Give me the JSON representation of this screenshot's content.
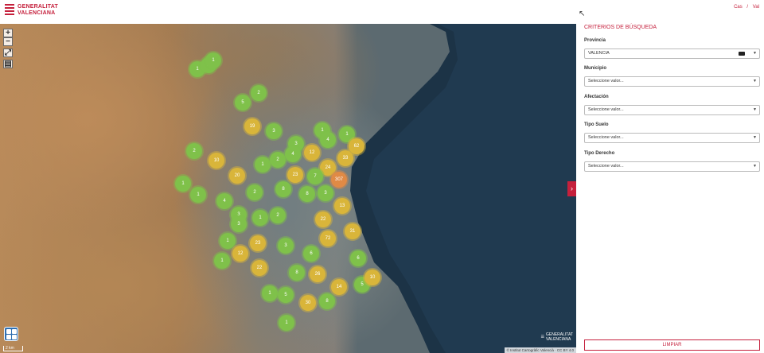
{
  "header": {
    "logo_line1": "GENERALITAT",
    "logo_line2": "VALENCIANA",
    "lang_es": "Cas",
    "lang_sep": "/",
    "lang_va": "Val"
  },
  "map": {
    "zoom_in": "+",
    "zoom_out": "−",
    "scale_text": "2 km",
    "attribution": "© Institut Cartogràfic Valencià · CC BY 4.0",
    "watermark_line1": "GENERALITAT",
    "watermark_line2": "VALENCIANA",
    "clusters": [
      {
        "label": "1",
        "color": "g",
        "c": 1
      },
      {
        "label": "1",
        "color": "g",
        "c": 2
      },
      {
        "label": "1",
        "color": "g",
        "c": 3
      },
      {
        "label": "5",
        "color": "g",
        "c": 4
      },
      {
        "label": "2",
        "color": "g",
        "c": 5
      },
      {
        "label": "19",
        "color": "y",
        "c": 6
      },
      {
        "label": "3",
        "color": "g",
        "c": 7
      },
      {
        "label": "1",
        "color": "g",
        "c": 8
      },
      {
        "label": "4",
        "color": "g",
        "c": 9
      },
      {
        "label": "1",
        "color": "g",
        "c": 10
      },
      {
        "label": "3",
        "color": "g",
        "c": 11
      },
      {
        "label": "62",
        "color": "y",
        "c": 12
      },
      {
        "label": "2",
        "color": "g",
        "c": 13
      },
      {
        "label": "10",
        "color": "y",
        "c": 14
      },
      {
        "label": "1",
        "color": "g",
        "c": 15
      },
      {
        "label": "2",
        "color": "g",
        "c": 16
      },
      {
        "label": "4",
        "color": "g",
        "c": 17
      },
      {
        "label": "12",
        "color": "y",
        "c": 18
      },
      {
        "label": "33",
        "color": "y",
        "c": 19
      },
      {
        "label": "20",
        "color": "y",
        "c": 20
      },
      {
        "label": "24",
        "color": "y",
        "c": 21
      },
      {
        "label": "23",
        "color": "y",
        "c": 22
      },
      {
        "label": "7",
        "color": "g",
        "c": 23
      },
      {
        "label": "1",
        "color": "g",
        "c": 24
      },
      {
        "label": "2",
        "color": "g",
        "c": 25
      },
      {
        "label": "8",
        "color": "g",
        "c": 26
      },
      {
        "label": "8",
        "color": "g",
        "c": 27
      },
      {
        "label": "3",
        "color": "g",
        "c": 28
      },
      {
        "label": "307",
        "color": "o",
        "c": 29
      },
      {
        "label": "1",
        "color": "g",
        "c": 30
      },
      {
        "label": "4",
        "color": "g",
        "c": 31
      },
      {
        "label": "3",
        "color": "g",
        "c": 32
      },
      {
        "label": "1",
        "color": "g",
        "c": 33
      },
      {
        "label": "2",
        "color": "g",
        "c": 34
      },
      {
        "label": "13",
        "color": "y",
        "c": 35
      },
      {
        "label": "3",
        "color": "g",
        "c": 36
      },
      {
        "label": "22",
        "color": "y",
        "c": 37
      },
      {
        "label": "31",
        "color": "y",
        "c": 38
      },
      {
        "label": "72",
        "color": "y",
        "c": 39
      },
      {
        "label": "1",
        "color": "g",
        "c": 40
      },
      {
        "label": "23",
        "color": "y",
        "c": 41
      },
      {
        "label": "3",
        "color": "g",
        "c": 42
      },
      {
        "label": "12",
        "color": "y",
        "c": 43
      },
      {
        "label": "6",
        "color": "g",
        "c": 44
      },
      {
        "label": "1",
        "color": "g",
        "c": 45
      },
      {
        "label": "22",
        "color": "y",
        "c": 46
      },
      {
        "label": "6",
        "color": "g",
        "c": 47
      },
      {
        "label": "26",
        "color": "y",
        "c": 48
      },
      {
        "label": "8",
        "color": "g",
        "c": 49
      },
      {
        "label": "14",
        "color": "y",
        "c": 50
      },
      {
        "label": "5",
        "color": "g",
        "c": 51
      },
      {
        "label": "10",
        "color": "y",
        "c": 52
      },
      {
        "label": "1",
        "color": "g",
        "c": 53
      },
      {
        "label": "5",
        "color": "g",
        "c": 54
      },
      {
        "label": "30",
        "color": "y",
        "c": 55
      },
      {
        "label": "8",
        "color": "g",
        "c": 56
      },
      {
        "label": "1",
        "color": "g",
        "c": 57
      }
    ]
  },
  "panel": {
    "title": "CRITERIOS DE BÚSQUEDA",
    "fields": [
      {
        "label": "Provincia",
        "value": "VALENCIA"
      },
      {
        "label": "Municipio",
        "value": "Seleccione valor..."
      },
      {
        "label": "Afectación",
        "value": "Seleccione valor..."
      },
      {
        "label": "Tipo Suelo",
        "value": "Seleccione valor..."
      },
      {
        "label": "Tipo Derecho",
        "value": "Seleccione valor..."
      }
    ],
    "clear_label": "LIMPIAR"
  },
  "colors": {
    "brand": "#c5203c",
    "cluster_small": "#7fc14a",
    "cluster_medium": "#d9b53a",
    "cluster_large": "#e08a45"
  }
}
